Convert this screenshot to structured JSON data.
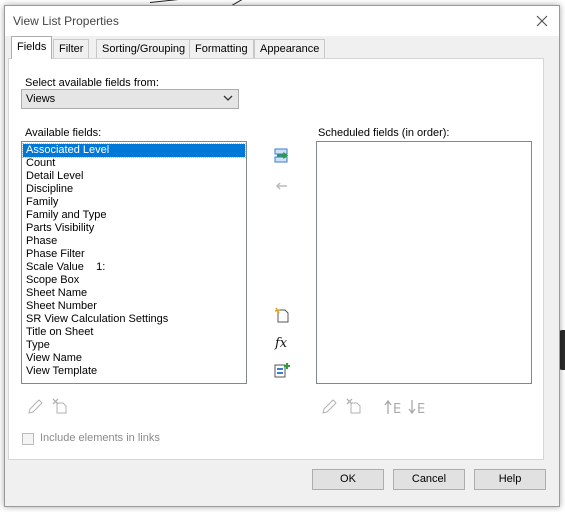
{
  "window": {
    "title": "View List Properties"
  },
  "tabs": [
    {
      "label": "Fields",
      "active": true
    },
    {
      "label": "Filter"
    },
    {
      "label": "Sorting/Grouping"
    },
    {
      "label": "Formatting"
    },
    {
      "label": "Appearance"
    }
  ],
  "fields_tab": {
    "select_label": "Select available fields from:",
    "select_value": "Views",
    "available_label": "Available fields:",
    "scheduled_label": "Scheduled fields (in order):",
    "available_fields": [
      "Associated Level",
      "Count",
      "Detail Level",
      "Discipline",
      "Family",
      "Family and Type",
      "Parts Visibility",
      "Phase",
      "Phase Filter",
      "Scale Value    1:",
      "Scope Box",
      "Sheet Name",
      "Sheet Number",
      "SR View Calculation Settings",
      "Title on Sheet",
      "Type",
      "View Name",
      "View Template"
    ],
    "selected_field": "Associated Level",
    "scheduled_fields": [],
    "include_links_label": "Include elements in links",
    "include_links_checked": false
  },
  "buttons": {
    "ok": "OK",
    "cancel": "Cancel",
    "help": "Help"
  },
  "icons": {
    "add": "add-parameter-icon",
    "remove": "remove-parameter-icon",
    "new_parameter": "new-parameter-icon",
    "calculated": "fx-calculated-value-icon",
    "combine": "combine-parameters-icon",
    "edit": "edit-pencil-icon",
    "delete": "delete-parameter-icon",
    "move_up": "move-up-icon",
    "move_down": "move-down-icon"
  },
  "colors": {
    "selection": "#0078d7",
    "accent_green": "#2e9e3a"
  }
}
